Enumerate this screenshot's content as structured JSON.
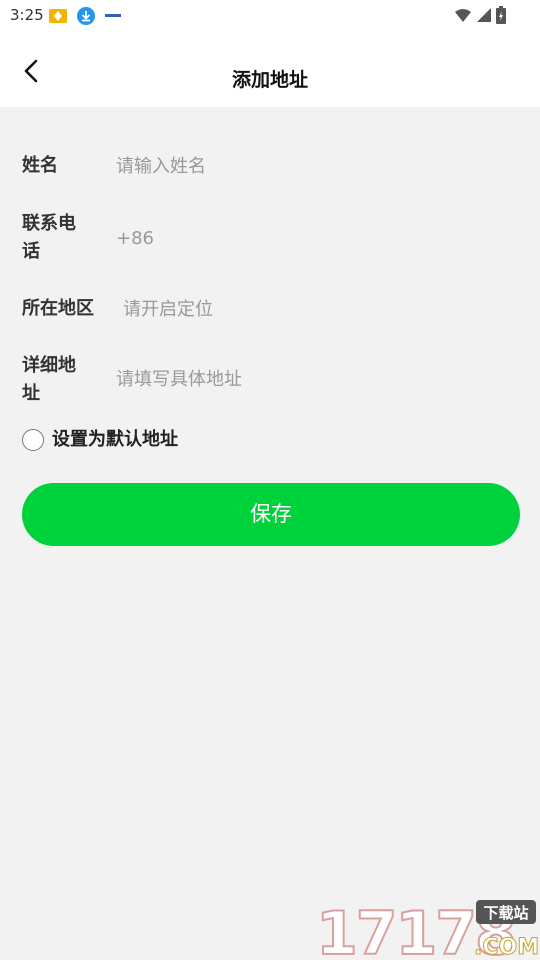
{
  "status_bar": {
    "time": "3:25"
  },
  "header": {
    "title": "添加地址"
  },
  "form": {
    "name": {
      "label": "姓名",
      "placeholder": "请输入姓名"
    },
    "phone": {
      "label": "联系电话",
      "prefix": "+86"
    },
    "region": {
      "label": "所在地区",
      "placeholder": "请开启定位"
    },
    "address": {
      "label": "详细地址",
      "placeholder": "请填写具体地址"
    }
  },
  "default_address": {
    "label": "设置为默认地址",
    "checked": false
  },
  "save_button": {
    "label": "保存"
  },
  "watermark": {
    "number": "17178",
    "tag": "下载站",
    "domain": ".COM"
  },
  "colors": {
    "accent": "#00d23c",
    "background": "#f2f2f2"
  }
}
